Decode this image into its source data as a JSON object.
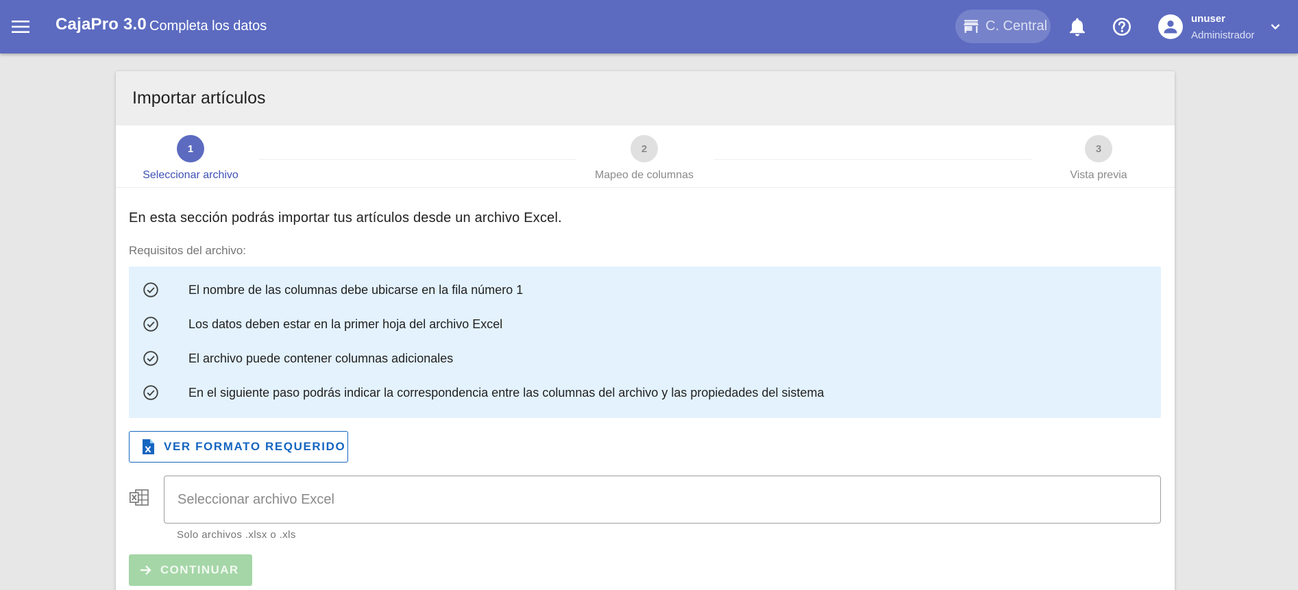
{
  "app": {
    "name": "CajaPro 3.0",
    "subtitle": "Completa los datos",
    "branch": "C. Central",
    "user": {
      "name": "unuser",
      "role": "Administrador"
    },
    "colors": {
      "primary": "#5c6bc0",
      "info_bg": "#e3f2fd",
      "outline_btn": "#1565c0",
      "continue_btn": "#a5d6a7"
    }
  },
  "icons": {
    "menu": "menu-icon",
    "store": "store-icon",
    "bell": "bell-icon",
    "help": "help-circle-icon",
    "user": "account-circle-icon",
    "caret": "chevron-down-icon",
    "check": "check-circle-outline-icon",
    "excel_doc": "file-excel-icon",
    "excel_grid": "microsoft-excel-icon",
    "arrow": "arrow-right-icon"
  },
  "card": {
    "title": "Importar artículos"
  },
  "stepper": {
    "steps": [
      {
        "number": "1",
        "label": "Seleccionar archivo",
        "state": "active"
      },
      {
        "number": "2",
        "label": "Mapeo de columnas",
        "state": "inactive"
      },
      {
        "number": "3",
        "label": "Vista previa",
        "state": "inactive"
      }
    ]
  },
  "content": {
    "intro": "En esta sección podrás importar tus artículos desde un archivo Excel.",
    "requirements_title": "Requisitos del archivo:",
    "requirements": [
      "El nombre de las columnas debe ubicarse en la fila número 1",
      "Los datos deben estar en la primer hoja del archivo Excel",
      "El archivo puede contener columnas adicionales",
      "En el siguiente paso podrás indicar la correspondencia entre las columnas del archivo y las propiedades del sistema"
    ],
    "format_button": "VER FORMATO REQUERIDO",
    "file_input": {
      "placeholder": "Seleccionar archivo Excel",
      "value": ""
    },
    "file_hint": "Solo archivos .xlsx o .xls",
    "continue_button": "CONTINUAR"
  }
}
